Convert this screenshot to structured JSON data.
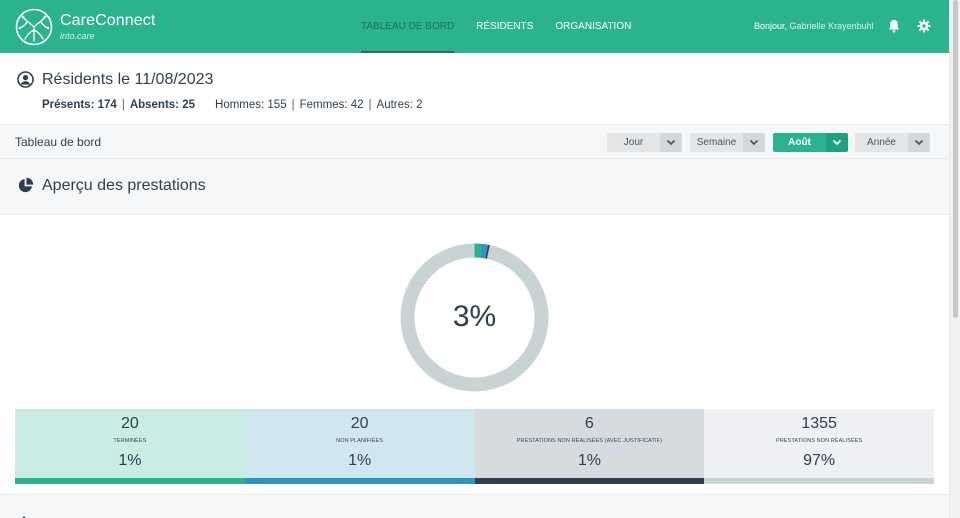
{
  "header": {
    "brand_name": "CareConnect",
    "brand_sub": "into.care",
    "nav": [
      {
        "label": "TABLEAU DE BORD",
        "active": true
      },
      {
        "label": "RÉSIDENTS",
        "active": false
      },
      {
        "label": "ORGANISATION",
        "active": false
      }
    ],
    "greeting": "Bonjour,",
    "user_name": "Gabrielle Krayenbuhl",
    "icons": [
      "bell-icon",
      "gear-icon"
    ]
  },
  "residents": {
    "title": "Résidents le 11/08/2023",
    "presents_label": "Présents:",
    "presents_value": "174",
    "absents_label": "Absents:",
    "absents_value": "25",
    "hommes": "Hommes: 155",
    "femmes": "Femmes: 42",
    "autres": "Autres: 2"
  },
  "dashboard": {
    "label": "Tableau de bord",
    "periods": [
      {
        "label": "Jour",
        "active": false
      },
      {
        "label": "Semaine",
        "active": false
      },
      {
        "label": "Août",
        "active": true
      },
      {
        "label": "Année",
        "active": false
      }
    ]
  },
  "overview": {
    "title": "Aperçu des prestations",
    "donut_label": "3%",
    "donut_fractions": [
      0.0145,
      0.0145,
      0.0044,
      0.9666
    ],
    "stats": [
      {
        "value": "20",
        "caption": "TERMINÉES",
        "percent": "1%",
        "bg": "#cbece4",
        "bar": "#2ab38e"
      },
      {
        "value": "20",
        "caption": "NON PLANIFIÉES",
        "percent": "1%",
        "bg": "#d0e7ef",
        "bar": "#2e95c0"
      },
      {
        "value": "6",
        "caption": "PRESTATIONS NON RÉALISÉES (AVEC JUSTIFICATIF)",
        "percent": "1%",
        "bg": "#d6dbe0",
        "bar": "#2f3e4c"
      },
      {
        "value": "1355",
        "caption": "PRESTATIONS NON RÉALISÉES",
        "percent": "97%",
        "bg": "#eef0f3",
        "bar": "#c8d4d3"
      }
    ]
  },
  "colors": {
    "accent": "#2ab38e",
    "donut_track": "#c8d4d3"
  }
}
